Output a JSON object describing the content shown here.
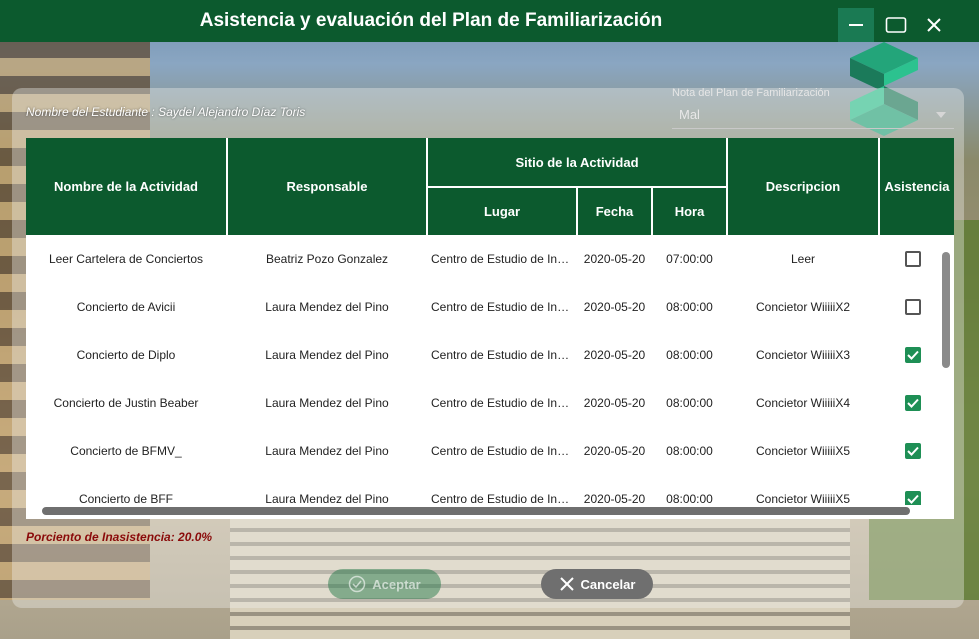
{
  "window": {
    "title": "Asistencia y evaluación del Plan de Familiarización",
    "controls": {
      "minimize": "minimize-icon",
      "maximize": "maximize-icon",
      "close": "close-icon"
    }
  },
  "student": {
    "label": "Nombre del Estudiante :  Saydel Alejandro Díaz Toris"
  },
  "grade": {
    "label": "Nota del Plan de Familiarización",
    "value": "Mal"
  },
  "table": {
    "headers": {
      "activity": "Nombre de la Actividad",
      "responsible": "Responsable",
      "site": "Sitio de la Actividad",
      "place": "Lugar",
      "date": "Fecha",
      "time": "Hora",
      "description": "Descripcion",
      "attendance": "Asistencia"
    },
    "rows": [
      {
        "activity": "Leer Cartelera de Conciertos",
        "responsible": "Beatriz Pozo Gonzalez",
        "place": "Centro de Estudio de Ingeniería",
        "date": "2020-05-20",
        "time": "07:00:00",
        "description": "Leer",
        "attendance": false
      },
      {
        "activity": "Concierto de Avicii",
        "responsible": "Laura Mendez del Pino",
        "place": "Centro de Estudio de Ingeniería",
        "date": "2020-05-20",
        "time": "08:00:00",
        "description": "Concietor WiiiiiX2",
        "attendance": false
      },
      {
        "activity": "Concierto de Diplo",
        "responsible": "Laura Mendez del Pino",
        "place": "Centro de Estudio de Ingeniería",
        "date": "2020-05-20",
        "time": "08:00:00",
        "description": "Concietor WiiiiiX3",
        "attendance": true
      },
      {
        "activity": "Concierto de Justin Beaber",
        "responsible": "Laura Mendez del Pino",
        "place": "Centro de Estudio de Ingeniería",
        "date": "2020-05-20",
        "time": "08:00:00",
        "description": "Concietor WiiiiiX4",
        "attendance": true
      },
      {
        "activity": "Concierto de BFMV_",
        "responsible": "Laura Mendez del Pino",
        "place": "Centro de Estudio de Ingeniería",
        "date": "2020-05-20",
        "time": "08:00:00",
        "description": "Concietor WiiiiiX5",
        "attendance": true
      },
      {
        "activity": "Concierto de BFF",
        "responsible": "Laura Mendez del Pino",
        "place": "Centro de Estudio de Ingeniería",
        "date": "2020-05-20",
        "time": "08:00:00",
        "description": "Concietor WiiiiiX5",
        "attendance": true
      }
    ]
  },
  "absence": {
    "text": "Porciento de Inasistencia: 20.0%"
  },
  "buttons": {
    "accept": "Aceptar",
    "cancel": "Cancelar"
  },
  "colors": {
    "primary": "#0c5a2e",
    "accent": "#1e8f55",
    "warning_text": "#8a0a0a"
  }
}
